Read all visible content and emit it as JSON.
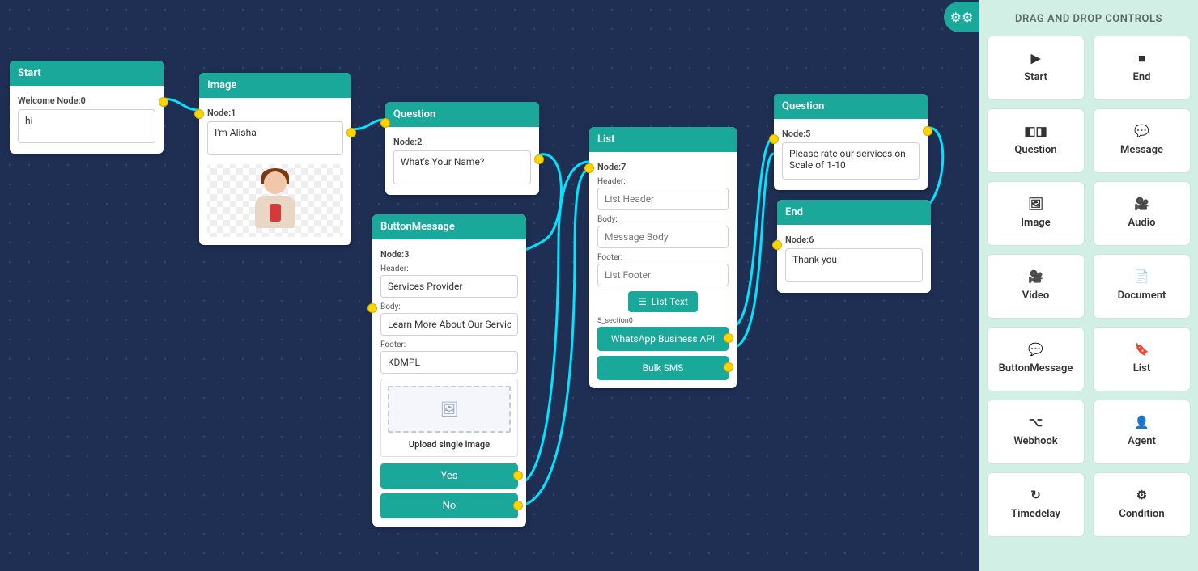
{
  "sidebar": {
    "title": "DRAG AND DROP CONTROLS",
    "controls": [
      {
        "icon": "▶",
        "label": "Start",
        "name": "start"
      },
      {
        "icon": "■",
        "label": "End",
        "name": "end"
      },
      {
        "icon": "◧◨",
        "label": "Question",
        "name": "question"
      },
      {
        "icon": "💬",
        "label": "Message",
        "name": "message"
      },
      {
        "icon": "🖼",
        "label": "Image",
        "name": "image"
      },
      {
        "icon": "🎥",
        "label": "Audio",
        "name": "audio"
      },
      {
        "icon": "🎥",
        "label": "Video",
        "name": "video"
      },
      {
        "icon": "📄",
        "label": "Document",
        "name": "document"
      },
      {
        "icon": "💬",
        "label": "ButtonMessage",
        "name": "buttonmessage"
      },
      {
        "icon": "🔖",
        "label": "List",
        "name": "list"
      },
      {
        "icon": "⌥",
        "label": "Webhook",
        "name": "webhook"
      },
      {
        "icon": "👤",
        "label": "Agent",
        "name": "agent"
      },
      {
        "icon": "↻",
        "label": "Timedelay",
        "name": "timedelay"
      },
      {
        "icon": "⚙",
        "label": "Condition",
        "name": "condition"
      }
    ]
  },
  "nodes": {
    "start": {
      "title": "Start",
      "label": "Welcome Node:0",
      "value": "hi"
    },
    "image": {
      "title": "Image",
      "label": "Node:1",
      "value": "I'm Alisha"
    },
    "question1": {
      "title": "Question",
      "label": "Node:2",
      "value": "What's Your Name?"
    },
    "buttonmsg": {
      "title": "ButtonMessage",
      "label": "Node:3",
      "header_label": "Header:",
      "header_value": "Services Provider",
      "body_label": "Body:",
      "body_value": "Learn More About Our Services",
      "footer_label": "Footer:",
      "footer_value": "KDMPL",
      "upload_text": "Upload single image",
      "btn_yes": "Yes",
      "btn_no": "No"
    },
    "list": {
      "title": "List",
      "label": "Node:7",
      "header_label": "Header:",
      "header_ph": "List Header",
      "body_label": "Body:",
      "body_ph": "Message Body",
      "footer_label": "Footer:",
      "footer_ph": "List Footer",
      "list_btn": "List Text",
      "section_label": "S_section0",
      "opt1": "WhatsApp Business API",
      "opt2": "Bulk SMS"
    },
    "question2": {
      "title": "Question",
      "label": "Node:5",
      "value": "Please rate our services on Scale of 1-10"
    },
    "end": {
      "title": "End",
      "label": "Node:6",
      "value": "Thank you"
    }
  }
}
